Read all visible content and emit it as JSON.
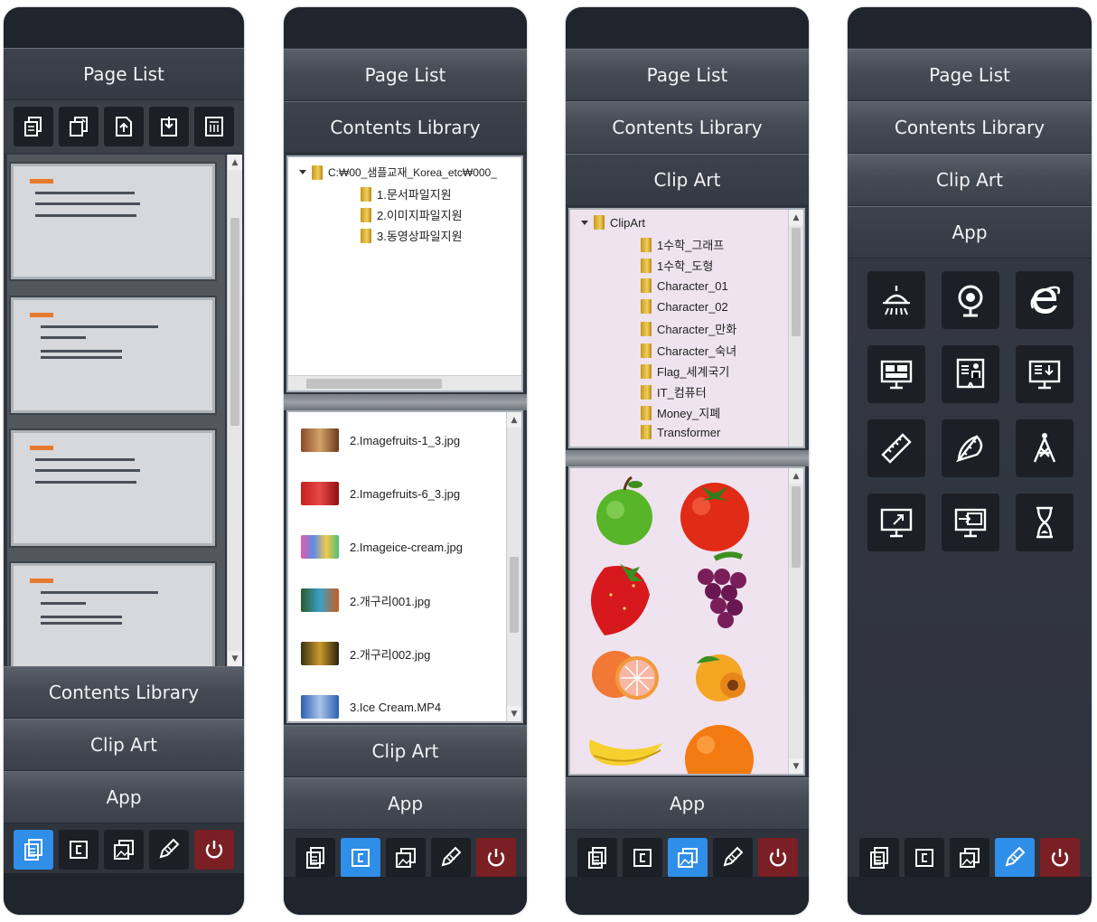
{
  "panels": [
    {
      "headers": [
        "Page List",
        "Contents Library",
        "Clip Art",
        "App"
      ],
      "active": "Page List"
    },
    {
      "headers": [
        "Page List",
        "Contents Library",
        "Clip Art",
        "App"
      ],
      "active": "Contents Library",
      "tree": {
        "root": "C:₩00_샘플교재_Korea_etc₩000_",
        "children": [
          "1.문서파일지원",
          "2.이미지파일지원",
          "3.동영상파일지원"
        ]
      },
      "files": [
        "2.Imagefruits-1_3.jpg",
        "2.Imagefruits-6_3.jpg",
        "2.Imageice-cream.jpg",
        "2.개구리001.jpg",
        "2.개구리002.jpg",
        "3.Ice Cream.MP4"
      ]
    },
    {
      "headers": [
        "Page List",
        "Contents Library",
        "Clip Art",
        "App"
      ],
      "active": "Clip Art",
      "tree": {
        "root": "ClipArt",
        "children": [
          "1수학_그래프",
          "1수학_도형",
          "Character_01",
          "Character_02",
          "Character_만화",
          "Character_숙녀",
          "Flag_세계국기",
          "IT_컴퓨터",
          "Money_지폐",
          "Transformer"
        ]
      }
    },
    {
      "headers": [
        "Page List",
        "Contents Library",
        "Clip Art",
        "App"
      ],
      "active": "App",
      "apps": [
        "ceiling-lamp-icon",
        "webcam-icon",
        "internet-explorer-icon",
        "monitor-layout-icon",
        "presenter-board-icon",
        "screen-download-icon",
        "ruler-icon",
        "protractor-icon",
        "compass-icon",
        "screen-capture-icon",
        "screen-share-icon",
        "hourglass-icon"
      ]
    }
  ],
  "bottom_tools": [
    "page-list-tool",
    "contents-tool",
    "clip-art-tool",
    "app-tool",
    "power"
  ],
  "colors": {
    "accent": "#2f8ee8",
    "power": "#7a1f24",
    "panel": "#2d323c"
  }
}
